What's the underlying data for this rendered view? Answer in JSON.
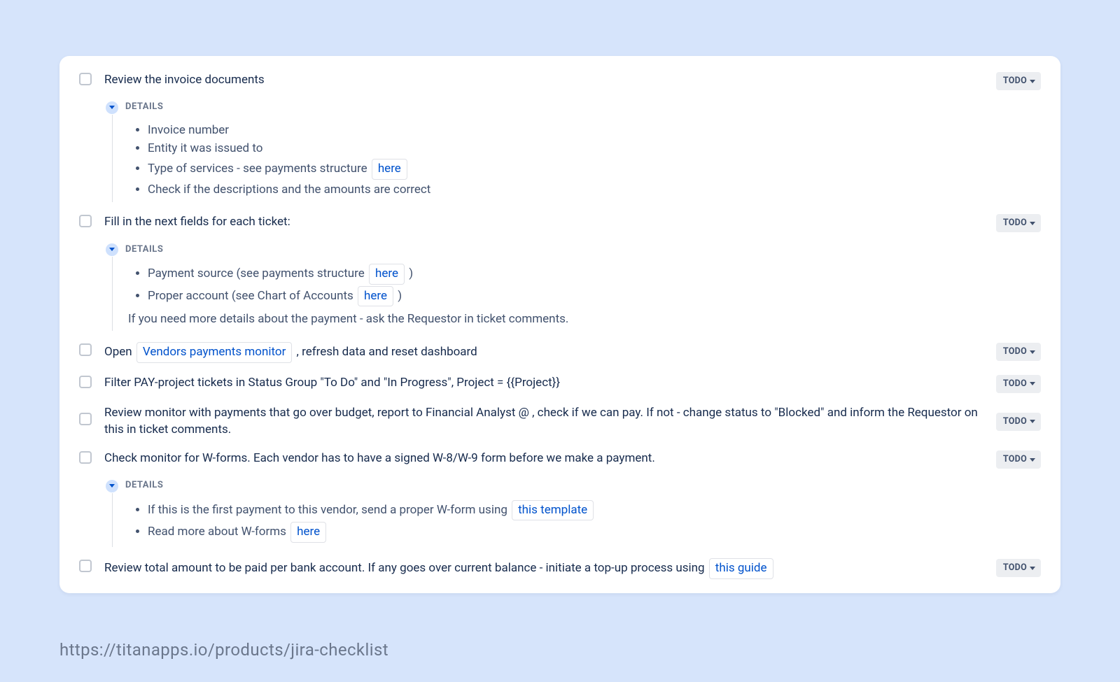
{
  "status_label": "TODO",
  "details_label": "DETAILS",
  "items": [
    {
      "title": "Review the invoice documents",
      "details": {
        "bullets_plain": [
          "Invoice number",
          "Entity it was issued to"
        ],
        "bullet_link": {
          "prefix": "Type of services - see payments structure ",
          "link": "here",
          "suffix": ""
        },
        "bullets_plain_after": [
          "Check if the descriptions and the amounts are correct"
        ]
      }
    },
    {
      "title": "Fill in the next fields for each ticket:",
      "details": {
        "bullets_links": [
          {
            "prefix": "Payment source (see payments structure ",
            "link": "here",
            "suffix": " )"
          },
          {
            "prefix": "Proper account (see Chart of Accounts ",
            "link": "here",
            "suffix": " )"
          }
        ],
        "note": "If you need more details about the payment - ask the Requestor in ticket comments."
      }
    },
    {
      "title_parts": {
        "prefix": "Open ",
        "link": "Vendors payments monitor",
        "suffix": " , refresh data and reset dashboard"
      }
    },
    {
      "title": "Filter PAY-project tickets in Status Group \"To Do\" and \"In Progress\", Project = {{Project}}"
    },
    {
      "title": "Review monitor with payments that go over budget, report to Financial Analyst @ , check if we can pay. If not - change status to \"Blocked\" and inform the Requestor on this in ticket comments."
    },
    {
      "title": "Check monitor for W-forms. Each vendor has to have a signed W-8/W-9 form before we make a payment.",
      "details": {
        "bullets_links": [
          {
            "prefix": "If this is the first payment to this vendor, send a proper W-form using ",
            "link": "this template",
            "suffix": ""
          },
          {
            "prefix": "Read more about W-forms ",
            "link": "here",
            "suffix": ""
          }
        ]
      }
    },
    {
      "title_parts": {
        "prefix": "Review total amount to be paid per bank account. If any goes over current balance - initiate a top-up process using ",
        "link": "this guide",
        "suffix": ""
      }
    }
  ],
  "source_url": "https://titanapps.io/products/jira-checklist"
}
